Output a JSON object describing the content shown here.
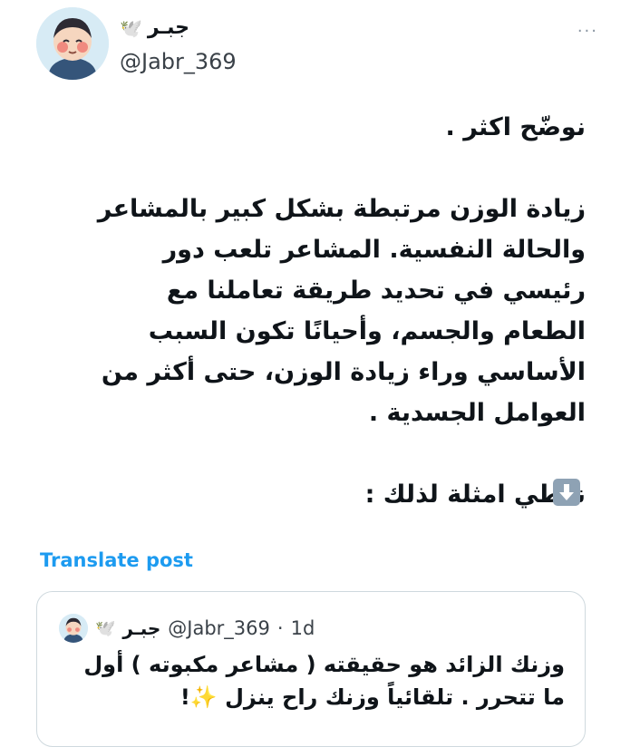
{
  "author": {
    "display_name": "جبـر",
    "handle": "@Jabr_369"
  },
  "more_label": "···",
  "tweet": {
    "paragraphs": [
      "نوضّح اكثر .",
      "زيادة الوزن مرتبطة بشكل كبير بالمشاعر والحالة النفسية. المشاعر تلعب دور رئيسي في تحديد طريقة تعاملنا مع الطعام والجسم، وأحيانًا تكون السبب الأساسي وراء زيادة الوزن، حتى أكثر من العوامل الجسدية .",
      "نعطي امثلة لذلك :"
    ]
  },
  "translate_label": "Translate post",
  "quote": {
    "display_name": "جبـر",
    "handle": "@Jabr_369",
    "separator": "·",
    "time": "1d",
    "text": "وزنك الزائد هو حقيقته ( مشاعر مكبوته ) أول ما تتحرر . تلقائياً وزنك راح ينزل ✨!"
  },
  "colors": {
    "accent": "#1d9bf0",
    "text": "#0f1419",
    "muted": "#3a4148",
    "border": "#cfd9de",
    "emoji_key": "#8ea2b4"
  },
  "icons": {
    "dove": "dove-icon",
    "more": "more-icon",
    "arrow": "down-arrow-icon"
  }
}
